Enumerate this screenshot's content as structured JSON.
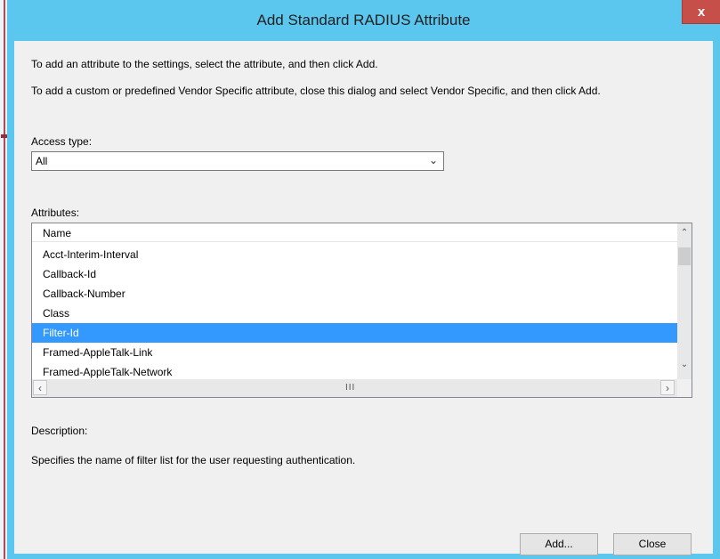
{
  "dialog": {
    "title": "Add Standard RADIUS Attribute",
    "close_glyph": "x"
  },
  "intro": {
    "line1": "To add an attribute to the settings, select the attribute, and then click Add.",
    "line2": "To add a custom or predefined Vendor Specific attribute, close this dialog and select Vendor Specific, and then click Add."
  },
  "access_type": {
    "label": "Access type:",
    "selected": "All"
  },
  "attributes": {
    "label": "Attributes:",
    "column_header": "Name",
    "items": [
      "Acct-Interim-Interval",
      "Callback-Id",
      "Callback-Number",
      "Class",
      "Filter-Id",
      "Framed-AppleTalk-Link",
      "Framed-AppleTalk-Network"
    ],
    "selected_item": "Filter-Id"
  },
  "description": {
    "label": "Description:",
    "text": "Specifies the name of filter list for the user requesting authentication."
  },
  "buttons": {
    "add": "Add...",
    "close": "Close"
  },
  "colors": {
    "title_bar": "#5bc6ee",
    "selection": "#3399ff",
    "close_button": "#c74f49"
  }
}
